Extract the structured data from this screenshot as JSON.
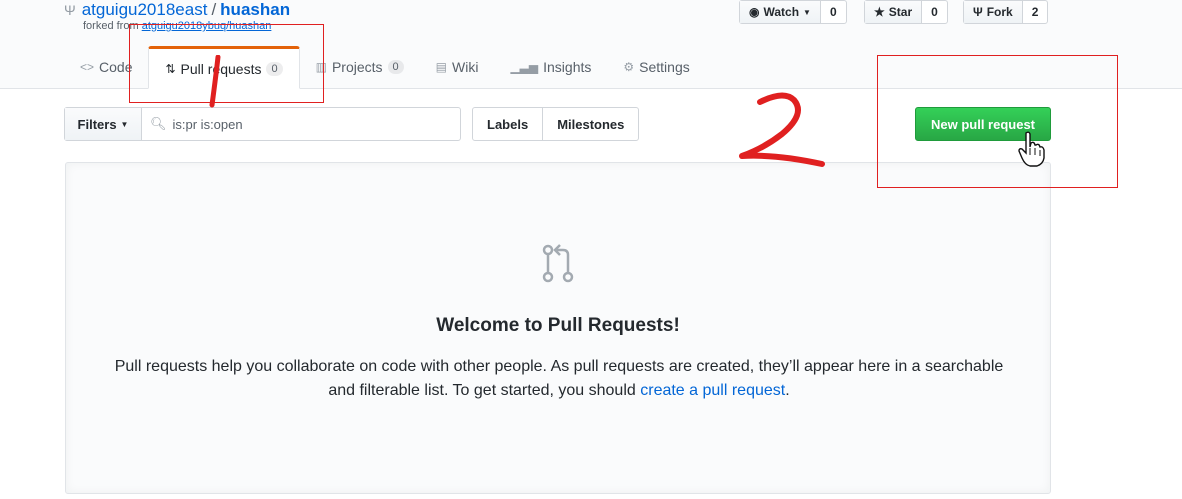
{
  "repo": {
    "owner": "atguigu2018east",
    "separator": "/",
    "name": "huashan",
    "forked_prefix": "forked from",
    "forked_from": "atguigu2018ybuq/huashan"
  },
  "social": {
    "watch_label": "Watch",
    "watch_count": "0",
    "star_label": "Star",
    "star_count": "0",
    "fork_label": "Fork",
    "fork_count": "2"
  },
  "tabs": [
    {
      "label": "Code"
    },
    {
      "label": "Pull requests",
      "counter": "0"
    },
    {
      "label": "Projects",
      "counter": "0"
    },
    {
      "label": "Wiki"
    },
    {
      "label": "Insights"
    },
    {
      "label": "Settings"
    }
  ],
  "toolbar": {
    "filters_label": "Filters",
    "search_value": "is:pr is:open",
    "labels_label": "Labels",
    "milestones_label": "Milestones",
    "new_pr_label": "New pull request"
  },
  "blankslate": {
    "title": "Welcome to Pull Requests!",
    "text_line1": "Pull requests help you collaborate on code with other people. As pull requests are created, they’ll appear here in a searchable",
    "text_line2_before": "and filterable list. To get started, you should",
    "link": "create a pull request",
    "text_line2_after": "."
  },
  "annotations": {
    "mark1": "1",
    "mark2": "2",
    "color": "#e02020"
  },
  "colors": {
    "link": "#0366d6",
    "primary_button": "#28a745",
    "active_tab_accent": "#e36209"
  }
}
